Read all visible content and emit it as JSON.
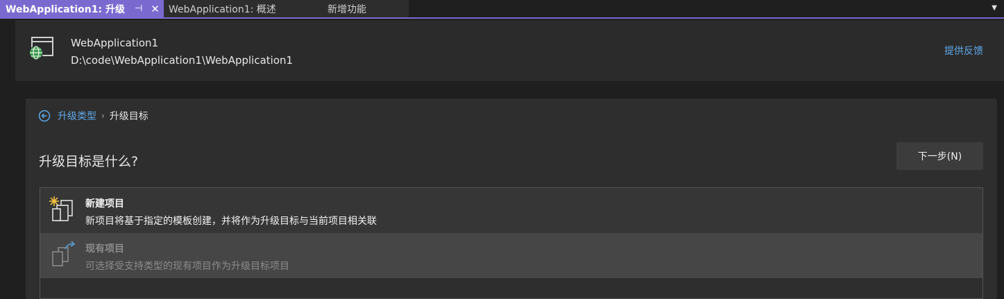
{
  "tabs": [
    {
      "label": "WebApplication1: 升级"
    },
    {
      "label": "WebApplication1: 概述"
    },
    {
      "label": "新增功能"
    }
  ],
  "header": {
    "project_name": "WebApplication1",
    "project_path": "D:\\code\\WebApplication1\\WebApplication1",
    "feedback_link": "提供反馈",
    "icon": "web-project-globe-icon"
  },
  "breadcrumb": {
    "back_icon": "back-arrow-circle-icon",
    "parent": "升级类型",
    "separator": "›",
    "current": "升级目标"
  },
  "main": {
    "question": "升级目标是什么?",
    "next_button": "下一步(N)"
  },
  "options": [
    {
      "title": "新建项目",
      "description": "新项目将基于指定的模板创建，并将作为升级目标与当前项目相关联",
      "icon": "new-project-icon",
      "state": "selected"
    },
    {
      "title": "现有项目",
      "description": "可选择受支持类型的现有项目作为升级目标项目",
      "icon": "existing-project-icon",
      "state": "disabled"
    }
  ],
  "colors": {
    "accent": "#7a6ad0",
    "link": "#5fa8e8",
    "background": "#1f1f1f"
  }
}
